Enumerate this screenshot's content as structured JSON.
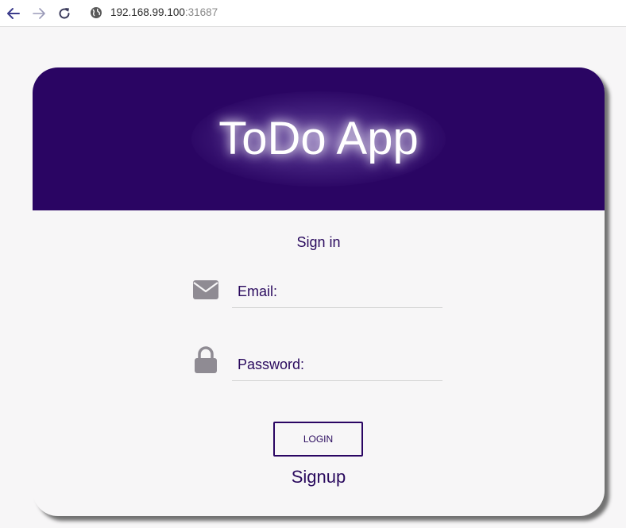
{
  "browser": {
    "url_host": "192.168.99.100",
    "url_port": ":31687"
  },
  "app": {
    "title": "ToDo App"
  },
  "form": {
    "heading": "Sign in",
    "email_label": "Email:",
    "password_label": "Password:",
    "login_label": "LOGIN",
    "signup_label": "Signup"
  },
  "colors": {
    "header_bg": "#2a0563",
    "accent_text": "#2a0a5e",
    "icon_gray": "#8f8b93"
  },
  "icons": {
    "back": "back-arrow-icon",
    "forward": "forward-arrow-icon",
    "reload": "reload-icon",
    "site": "globe-icon",
    "email": "envelope-icon",
    "password": "lock-icon"
  }
}
